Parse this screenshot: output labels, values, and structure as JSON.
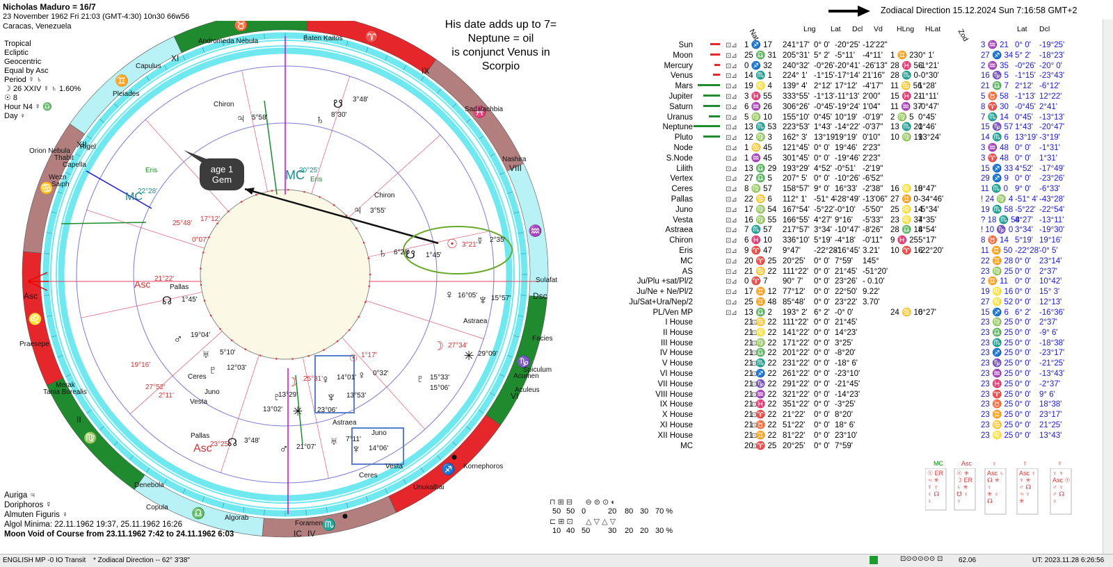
{
  "header": {
    "chart_name": "Nicholas Maduro = 16/7",
    "birth_line": "23 November 1962  Fri  21:03 (GMT-4:30) 10n30  66w56",
    "place": "Caracas, Venezuela",
    "direction_label": "Zodiacal Direction 15.12.2024  Sun  7:16:58 GMT+2"
  },
  "chart_info": [
    "Tropical",
    "Ecliptic",
    "Geocentric",
    "Equal by Asc",
    "Period ☿ ♄",
    "☽  26 XXIV ☿ ♄ 1.60%",
    "☉  8",
    "Hour N4 ☿ ♎",
    "Day ♀"
  ],
  "annotation": {
    "note_lines": [
      "His date adds up to 7=",
      "Neptune = oil",
      "is conjunct Venus in",
      "Scorpio"
    ],
    "bubble_lines": [
      "age 1",
      "Gem"
    ]
  },
  "bottom_info": {
    "lines": [
      "Auriga ♃",
      "Doriphoros ☿",
      "Almuten Figuris  ♀",
      "Algol Minima: 22.11.1962 19:37,  25.11.1962 16:26"
    ],
    "void": "Moon Void of Course from 23.11.1962  7:42 to 24.11.1962  6:03"
  },
  "wheel_labels": {
    "stars": [
      "Baten Kaitos",
      "Andromeda Nebula",
      "Capulus",
      "Pleiades",
      "Orion Nebula",
      "Thabit",
      "Capella",
      "Wezn",
      "Saiph",
      "Rigel",
      "Sadalachbia",
      "Nashira",
      "Sulafat",
      "Facies",
      "Spiculum",
      "Acumen",
      "Aculeus",
      "Kornephoros",
      "Unukalhai",
      "Foramen",
      "Algorab",
      "Copula",
      "Denebola",
      "Tania Borealis",
      "Merak",
      "Praesepe"
    ],
    "houses": [
      "XI",
      "IX",
      "XII",
      "VIII",
      "VI",
      "II",
      "IC",
      "IV"
    ],
    "angles": [
      "Asc",
      "Dsc",
      "MC",
      "MC",
      "Asc",
      "Asc"
    ],
    "positions": [
      "5°58'",
      "8°30'",
      "3°48'",
      "20°25'",
      "22°28'",
      "25°48'",
      "17°12'",
      "0°07'",
      "21°22'",
      "1°45'",
      "19°04'",
      "5°10'",
      "12°03'",
      "19°16'",
      "27°52'",
      "2°11'",
      "13°29'",
      "13°02'",
      "25°31'",
      "14°01'",
      "13°53'",
      "1°17'",
      "0°32'",
      "15°33'",
      "15°06'",
      "3°21'",
      "2°35'",
      "1°45'",
      "6°26'",
      "3°55'",
      "16°05'",
      "15°57'",
      "27°34'",
      "29°09'",
      "23°06'",
      "7°11'",
      "14°06'",
      "21°07'",
      "23°25'",
      "3°48'"
    ],
    "body_labels": [
      "Chiron",
      "Chiron",
      "Eris",
      "Eris",
      "Pallas",
      "Pallas",
      "Ceres",
      "Ceres",
      "Juno",
      "Juno",
      "Vesta",
      "Vesta",
      "Astraea",
      "Astraea"
    ]
  },
  "table": {
    "headers": [
      "Nat",
      "Lng",
      "Lat",
      "Dcl",
      "Vd",
      "HLng",
      "HLat",
      "Zod",
      "Lat",
      "Dcl"
    ],
    "planets": [
      {
        "name": "Sun",
        "nat": "1 ♐ 17",
        "lng": "241°17'",
        "lat": "0° 0'",
        "dcl": "-20°25'",
        "vd": "-12'22\"",
        "hlng": "",
        "hlat": "",
        "zod": "3 ♒ 21",
        "zlat": "0° 0'",
        "zdcl": "-19°25'"
      },
      {
        "name": "Moon",
        "nat": "25 ♎ 31",
        "lng": "205°31'",
        "lat": "5° 2'",
        "dcl": "-5°11'",
        "vd": "-4°11'",
        "hlng": "1 ♊ 23",
        "hlat": "0° 1'",
        "zod": "27 ♐ 34",
        "zlat": "5° 2'",
        "zdcl": "-18°23'"
      },
      {
        "name": "Mercury",
        "nat": "0 ♐ 32",
        "lng": "240°32'",
        "lat": "-0°26'",
        "dcl": "-20°41'",
        "vd": "-26'13\"",
        "hlng": "28 ♓ 56",
        "hlat": "-1°21'",
        "zod": "2 ♒ 35",
        "zlat": "-0°26'",
        "zdcl": "-20° 0'"
      },
      {
        "name": "Venus",
        "nat": "14 ♏ 1",
        "lng": "224° 1'",
        "lat": "-1°15'",
        "dcl": "-17°14'",
        "vd": "21'16\"",
        "hlng": "28 ♏ 0",
        "hlat": "-0°30'",
        "zod": "16 ♑ 5",
        "zlat": "-1°15'",
        "zdcl": "-23°43'"
      },
      {
        "name": "Mars",
        "nat": "19 ♌ 4",
        "lng": "139° 4'",
        "lat": "2°12'",
        "dcl": "17°12'",
        "vd": "-4'17\"",
        "hlng": "11 ♋ 56",
        "hlat": "1°28'",
        "zod": "21 ♎ 7",
        "zlat": "2°12'",
        "zdcl": "-6°12'"
      },
      {
        "name": "Jupiter",
        "nat": "3 ♓ 55",
        "lng": "333°55'",
        "lat": "-1°13'",
        "dcl": "-11°13'",
        "vd": "2'00\"",
        "hlng": "15 ♓ 21",
        "hlat": "-1°11'",
        "zod": "5 ♉ 58",
        "zlat": "-1°13'",
        "zdcl": "12°22'"
      },
      {
        "name": "Saturn",
        "nat": "6 ♒ 26",
        "lng": "306°26'",
        "lat": "-0°45'",
        "dcl": "-19°24'",
        "vd": "1'04\"",
        "hlng": "11 ♒ 37",
        "hlat": "-0°47'",
        "zod": "8 ♈ 30",
        "zlat": "-0°45'",
        "zdcl": "2°41'"
      },
      {
        "name": "Uranus",
        "nat": "5 ♍ 10",
        "lng": "155°10'",
        "lat": "0°45'",
        "dcl": "10°19'",
        "vd": "-0'19\"",
        "hlng": "2 ♍ 5",
        "hlat": "0°45'",
        "zod": "7 ♏ 14",
        "zlat": "0°45'",
        "zdcl": "-13°13'"
      },
      {
        "name": "Neptune",
        "nat": "13 ♏ 53",
        "lng": "223°53'",
        "lat": "1°43'",
        "dcl": "-14°22'",
        "vd": "-0'37\"",
        "hlng": "13 ♏ 20",
        "hlat": "1°46'",
        "zod": "15 ♑ 57",
        "zlat": "1°43'",
        "zdcl": "-20°47'"
      },
      {
        "name": "Pluto",
        "nat": "12 ♍ 3",
        "lng": "162° 3'",
        "lat": "13°19'",
        "dcl": "19°19'",
        "vd": "0'10\"",
        "hlng": "10 ♍ 19",
        "hlat": "13°24'",
        "zod": "14 ♏ 6",
        "zlat": "13°19'",
        "zdcl": "-3°19'"
      },
      {
        "name": "Node",
        "nat": "1 ♋ 45",
        "lng": "121°45'",
        "lat": "0° 0'",
        "dcl": "19°46'",
        "vd": "2'23\"",
        "hlng": "",
        "hlat": "",
        "zod": "3 ♒ 48",
        "zlat": "0° 0'",
        "zdcl": "-1°31'"
      },
      {
        "name": "S.Node",
        "nat": "1 ♒ 45",
        "lng": "301°45'",
        "lat": "0° 0'",
        "dcl": "-19°46'",
        "vd": "2'23\"",
        "hlng": "",
        "hlat": "",
        "zod": "3 ♈ 48",
        "zlat": "0° 0'",
        "zdcl": "1°31'"
      },
      {
        "name": "Lilith",
        "nat": "13 ♎ 29",
        "lng": "193°29'",
        "lat": "4°52'",
        "dcl": "-0°51'",
        "vd": "-2'19\"",
        "hlng": "",
        "hlat": "",
        "zod": "15 ♐ 33",
        "zlat": "4°52'",
        "zdcl": "-17°49'"
      },
      {
        "name": "Vertex",
        "nat": "27 ♎ 5",
        "lng": "207° 5'",
        "lat": "0° 0'",
        "dcl": "-10°26'",
        "vd": "-6'52\"",
        "hlng": "",
        "hlat": "",
        "zod": "29 ♐ 9",
        "zlat": "0° 0'",
        "zdcl": "-23°26'"
      },
      {
        "name": "Ceres",
        "nat": "8 ♍ 57",
        "lng": "158°57'",
        "lat": "9° 0'",
        "dcl": "16°33'",
        "vd": "-2'38\"",
        "hlng": "16 ♌ 10",
        "hlat": "8°47'",
        "zod": "11 ♏ 0",
        "zlat": "9° 0'",
        "zdcl": "-6°33'"
      },
      {
        "name": "Pallas",
        "nat": "22 ♋ 6",
        "lng": "112° 1'",
        "lat": "-51° 4'",
        "dcl": "-28°49'",
        "vd": "-13'06\"",
        "hlng": "27 ♊ 0",
        "hlat": "-34°46'",
        "zod": "! 24 ♍ 4",
        "zlat": "-51° 4'",
        "zdcl": "-43°28'"
      },
      {
        "name": "Juno",
        "nat": "17 ♍ 54",
        "lng": "167°54'",
        "lat": "-5°22'",
        "dcl": "-0°10'",
        "vd": "-5'50\"",
        "hlng": "25 ♌ 14",
        "hlat": "-5°34'",
        "zod": "19 ♏ 58",
        "zlat": "-5°22'",
        "zdcl": "-22°54'"
      },
      {
        "name": "Vesta",
        "nat": "16 ♍ 55",
        "lng": "166°55'",
        "lat": "4°27'",
        "dcl": "9°16'",
        "vd": "-5'33\"",
        "hlng": "23 ♌ 37",
        "hlat": "4°35'",
        "zod": "? 18 ♏ 58",
        "zlat": "4°27'",
        "zdcl": "-13°11'"
      },
      {
        "name": "Astraea",
        "nat": "7 ♏ 57",
        "lng": "217°57'",
        "lat": "3°34'",
        "dcl": "-10°47'",
        "vd": "-8'26\"",
        "hlng": "28 ♎ 18",
        "hlat": "4°54'",
        "zod": "! 10 ♑ 0",
        "zlat": "3°34'",
        "zdcl": "-19°30'"
      },
      {
        "name": "Chiron",
        "nat": "6 ♓ 10",
        "lng": "336°10'",
        "lat": "5°19'",
        "dcl": "-4°18'",
        "vd": "-0'11\"",
        "hlng": "9 ♓ 25",
        "hlat": "5°17'",
        "zod": "8 ♉ 14",
        "zlat": "5°19'",
        "zdcl": "19°16'"
      },
      {
        "name": "Eris",
        "nat": "9 ♈ 47",
        "lng": "9°47'",
        "lat": "-22°28'",
        "dcl": "-16°45'",
        "vd": "3.21'",
        "hlng": "10 ♈ 16",
        "hlat": "-22°20'",
        "zod": "11 ♊ 50",
        "zlat": "-22°28'",
        "zdcl": "-0° 5'"
      },
      {
        "name": "MC",
        "nat": "20 ♈ 25",
        "lng": "20°25'",
        "lat": "0° 0'",
        "dcl": "7°59'",
        "vd": "145°",
        "hlng": "",
        "hlat": "",
        "zod": "22 ♊ 28",
        "zlat": "0° 0'",
        "zdcl": "23°14'"
      },
      {
        "name": "AS",
        "nat": "21 ♋ 22",
        "lng": "111°22'",
        "lat": "0° 0'",
        "dcl": "21°45'",
        "vd": "-51°20'",
        "hlng": "",
        "hlat": "",
        "zod": "23 ♍ 25",
        "zlat": "0° 0'",
        "zdcl": "2°37'"
      },
      {
        "name": "Ju/Plu +sat/Pl/2",
        "nat": "0 ♈ 7",
        "lng": "90° 7'",
        "lat": "0° 0'",
        "dcl": "23°26'",
        "vd": "- 0.10'",
        "hlng": "",
        "hlat": "",
        "zod": "2 ♊ 11",
        "zlat": "0° 0'",
        "zdcl": "10°42'"
      },
      {
        "name": "Ju/Ne + Ne/Pl/2",
        "nat": "17 ♊ 12",
        "lng": "77°12'",
        "lat": "0° 0'",
        "dcl": "22°50'",
        "vd": "9.22'",
        "hlng": "",
        "hlat": "",
        "zod": "19 ♌ 16",
        "zlat": "0° 0'",
        "zdcl": "15° 3'"
      },
      {
        "name": "Ju/Sat+Ura/Nep/2",
        "nat": "25 ♊ 48",
        "lng": "85°48'",
        "lat": "0° 0'",
        "dcl": "23°22'",
        "vd": "3.70'",
        "hlng": "",
        "hlat": "",
        "zod": "27 ♌ 52",
        "zlat": "0° 0'",
        "zdcl": "12°13'"
      },
      {
        "name": "PL/Ven MP",
        "nat": "13 ♎ 2",
        "lng": "193° 2'",
        "lat": "6° 2'",
        "dcl": "-0° 0'",
        "vd": "",
        "hlng": "24 ♋ 10",
        "hlat": "6°27'",
        "zod": "15 ♐ 6",
        "zlat": "6° 2'",
        "zdcl": "-16°36'"
      }
    ],
    "houses": [
      {
        "name": "I House",
        "nat": "21 ♋ 22",
        "lng": "111°22'",
        "lat": "0° 0'",
        "dcl": "21°45'",
        "zod": "23 ♍ 25",
        "zlat": "0° 0'",
        "zdcl": "2°37'"
      },
      {
        "name": "II House",
        "nat": "21 ♌ 22",
        "lng": "141°22'",
        "lat": "0° 0'",
        "dcl": "14°23'",
        "zod": "23 ♎ 25",
        "zlat": "0° 0'",
        "zdcl": "-9° 6'"
      },
      {
        "name": "III House",
        "nat": "21 ♍ 22",
        "lng": "171°22'",
        "lat": "0° 0'",
        "dcl": "3°25'",
        "zod": "23 ♏ 25",
        "zlat": "0° 0'",
        "zdcl": "-18°38'"
      },
      {
        "name": "IV House",
        "nat": "21 ♎ 22",
        "lng": "201°22'",
        "lat": "0° 0'",
        "dcl": "-8°20'",
        "zod": "23 ♐ 25",
        "zlat": "0° 0'",
        "zdcl": "-23°17'"
      },
      {
        "name": "V House",
        "nat": "21 ♏ 22",
        "lng": "231°22'",
        "lat": "0° 0'",
        "dcl": "-18° 6'",
        "zod": "23 ♑ 25",
        "zlat": "0° 0'",
        "zdcl": "-21°25'"
      },
      {
        "name": "VI House",
        "nat": "21 ♐ 22",
        "lng": "261°22'",
        "lat": "0° 0'",
        "dcl": "-23°10'",
        "zod": "23 ♒ 25",
        "zlat": "0° 0'",
        "zdcl": "-13°43'"
      },
      {
        "name": "VII House",
        "nat": "21 ♑ 22",
        "lng": "291°22'",
        "lat": "0° 0'",
        "dcl": "-21°45'",
        "zod": "23 ♓ 25",
        "zlat": "0° 0'",
        "zdcl": "-2°37'"
      },
      {
        "name": "VIII House",
        "nat": "21 ♒ 22",
        "lng": "321°22'",
        "lat": "0° 0'",
        "dcl": "-14°23'",
        "zod": "23 ♈ 25",
        "zlat": "0° 0'",
        "zdcl": "9° 6'"
      },
      {
        "name": "IX House",
        "nat": "21 ♓ 22",
        "lng": "351°22'",
        "lat": "0° 0'",
        "dcl": "-3°25'",
        "zod": "23 ♉ 25",
        "zlat": "0° 0'",
        "zdcl": "18°38'"
      },
      {
        "name": "X House",
        "nat": "21 ♈ 22",
        "lng": "21°22'",
        "lat": "0° 0'",
        "dcl": "8°20'",
        "zod": "23 ♊ 25",
        "zlat": "0° 0'",
        "zdcl": "23°17'"
      },
      {
        "name": "XI House",
        "nat": "21 ♉ 22",
        "lng": "51°22'",
        "lat": "0° 0'",
        "dcl": "18° 6'",
        "zod": "23 ♋ 25",
        "zlat": "0° 0'",
        "zdcl": "21°25'"
      },
      {
        "name": "XII House",
        "nat": "21 ♊ 22",
        "lng": "81°22'",
        "lat": "0° 0'",
        "dcl": "23°10'",
        "zod": "23 ♌ 25",
        "zlat": "0° 0'",
        "zdcl": "13°43'"
      },
      {
        "name": "MC",
        "nat": "20 ♈ 25",
        "lng": "20°25'",
        "lat": "0° 0'",
        "dcl": "7°59'",
        "zod": "",
        "zlat": "",
        "zdcl": ""
      }
    ]
  },
  "stats": {
    "row1": [
      "50",
      "50",
      "0",
      "20",
      "80",
      "30",
      "70 %"
    ],
    "row2": [
      "10",
      "40",
      "50",
      "30",
      "20",
      "20",
      "30 %"
    ]
  },
  "statusbar": {
    "left": "ENGLISH MP -0 IO Transit",
    "mid": "* Zodiacal Direction -- 62° 3'38\"",
    "zoom": "62.06",
    "ut": "UT: 2023.11.28  6:26:56"
  },
  "colors": {
    "cyan_band": "#6fe8f0",
    "light_cyan": "#b8f2f6",
    "red_sign": "#e5262b",
    "green_sign": "#1f8a2e",
    "mauve_sign": "#b27e7e",
    "direction_blue": "#1a1ad0",
    "table_red": "#cc1111"
  }
}
